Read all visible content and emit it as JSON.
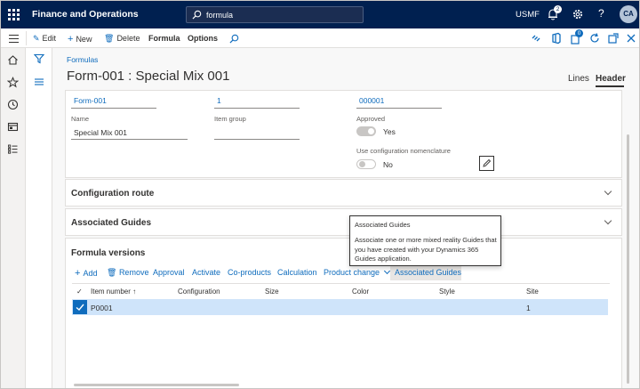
{
  "topbar": {
    "app_title": "Finance and Operations",
    "search_value": "formula",
    "company": "USMF",
    "notification_count": "2",
    "avatar_initials": "CA"
  },
  "actions": {
    "edit": "Edit",
    "new": "New",
    "delete": "Delete",
    "formula": "Formula",
    "options": "Options",
    "badge_count": "0"
  },
  "page": {
    "breadcrumb": "Formulas",
    "title": "Form-001 : Special Mix 001",
    "view_lines": "Lines",
    "view_header": "Header"
  },
  "header_fields": {
    "formula_id": "Form-001",
    "version": "1",
    "item_number": "000001",
    "name_label": "Name",
    "name_value": "Special Mix 001",
    "item_group_label": "Item group",
    "item_group_value": "",
    "approved_label": "Approved",
    "approved_value": "Yes",
    "approved_on": true,
    "config_label": "Use configuration nomenclature",
    "config_value": "No",
    "config_on": false
  },
  "fasttabs": {
    "config_route": "Configuration route",
    "associated_guides": "Associated Guides",
    "formula_versions": "Formula versions"
  },
  "grid_toolbar": {
    "add": "Add",
    "remove": "Remove",
    "approval": "Approval",
    "activate": "Activate",
    "coproducts": "Co-products",
    "calculation": "Calculation",
    "product_change": "Product change",
    "associated_guides": "Associated Guides"
  },
  "grid": {
    "columns": [
      "Item number",
      "Configuration",
      "Size",
      "Color",
      "Style",
      "Site"
    ],
    "rows": [
      {
        "item_number": "P0001",
        "configuration": "",
        "size": "",
        "color": "",
        "style": "",
        "site": "1"
      }
    ]
  },
  "tooltip": {
    "title": "Associated Guides",
    "body": "Associate one or more mixed reality Guides that you have created with your Dynamics 365 Guides application."
  },
  "colors": {
    "topbar": "#002050",
    "accent": "#0f6cbd",
    "selected_row": "#cfe4fa"
  }
}
